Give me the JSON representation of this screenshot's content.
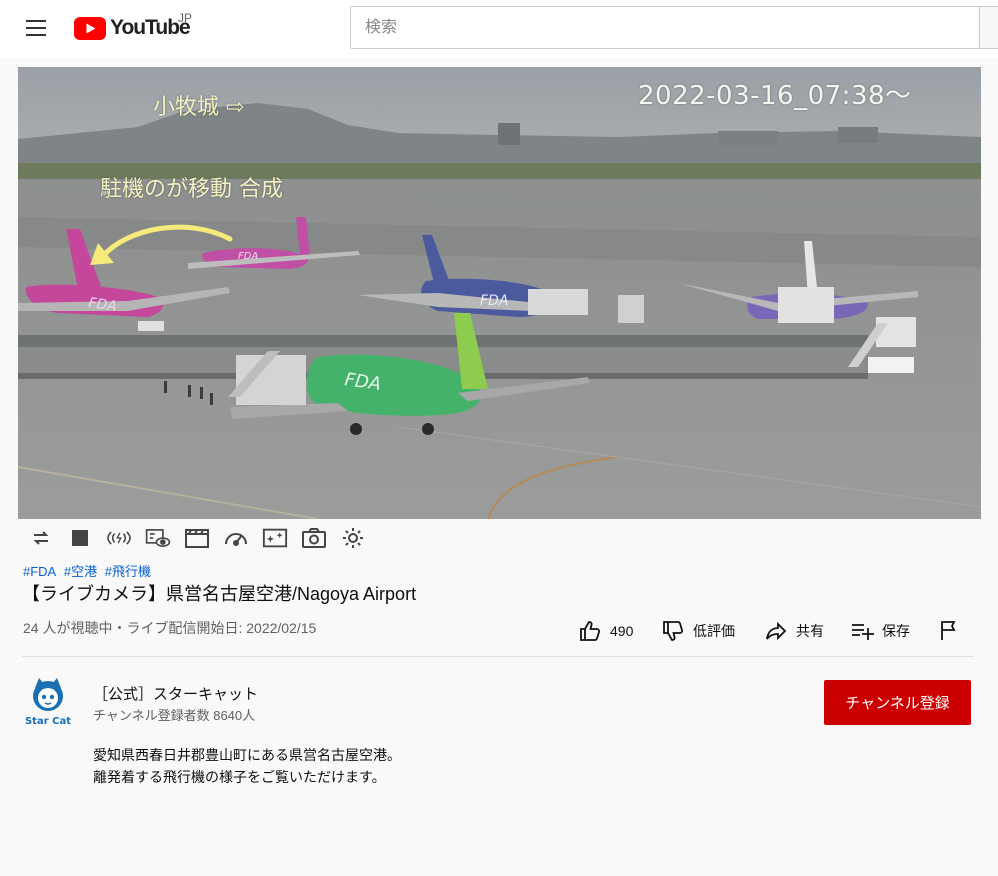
{
  "masthead": {
    "logo_text": "YouTube",
    "country_code": "JP",
    "search_placeholder": "検索"
  },
  "video": {
    "overlay_timestamp": "2022-03-16_07:38〜",
    "overlay_castle": "小牧城 ⇨",
    "overlay_note": "駐機のが移動 合成",
    "fuselage_labels": [
      "FDA",
      "FDA",
      "FDA",
      "FDA"
    ]
  },
  "controls": [
    {
      "name": "loop-icon"
    },
    {
      "name": "stop-icon"
    },
    {
      "name": "broadcast-icon"
    },
    {
      "name": "camera-view-icon"
    },
    {
      "name": "clapperboard-icon"
    },
    {
      "name": "speedometer-icon"
    },
    {
      "name": "sparkle-frame-icon"
    },
    {
      "name": "snapshot-camera-icon"
    },
    {
      "name": "settings-gear-icon"
    }
  ],
  "hashtags": [
    "#FDA",
    "#空港",
    "#飛行機"
  ],
  "title": "【ライブカメラ】県営名古屋空港/Nagoya Airport",
  "meta": "24 人が視聴中・ライブ配信開始日: 2022/02/15",
  "actions": {
    "like_count": "490",
    "dislike_label": "低評価",
    "share_label": "共有",
    "save_label": "保存"
  },
  "channel": {
    "name": "［公式］スターキャット",
    "subscribers": "チャンネル登録者数 8640人",
    "avatar_text": "Star Cat",
    "subscribe_label": "チャンネル登録"
  },
  "description": [
    "愛知県西春日井郡豊山町にある県営名古屋空港。",
    "離発着する飛行機の様子をご覧いただけます。"
  ],
  "colors": {
    "brand_red": "#ff0000",
    "subscribe_red": "#cc0000",
    "link_blue": "#065fd4"
  }
}
